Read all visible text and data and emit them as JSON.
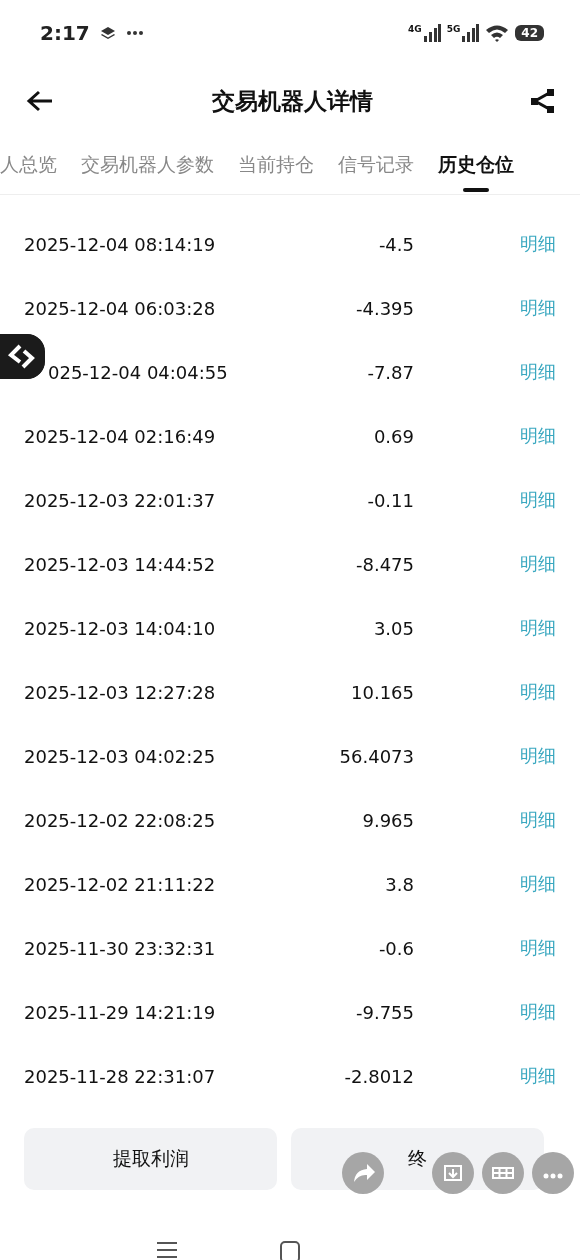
{
  "status_bar": {
    "time": "2:17",
    "network_1": "4G",
    "network_2": "5G",
    "battery": "42"
  },
  "header": {
    "title": "交易机器人详情"
  },
  "tabs": [
    {
      "label": "人总览",
      "selected": false
    },
    {
      "label": "交易机器人参数",
      "selected": false
    },
    {
      "label": "当前持仓",
      "selected": false
    },
    {
      "label": "信号记录",
      "selected": false
    },
    {
      "label": "历史仓位",
      "selected": true
    }
  ],
  "rows": [
    {
      "time": "2025-12-04 08:14:19",
      "value": "-4.5",
      "link": "明细"
    },
    {
      "time": "2025-12-04 06:03:28",
      "value": "-4.395",
      "link": "明细"
    },
    {
      "time": "025-12-04 04:04:55",
      "value": "-7.87",
      "link": "明细",
      "partial": true
    },
    {
      "time": "2025-12-04 02:16:49",
      "value": "0.69",
      "link": "明细"
    },
    {
      "time": "2025-12-03 22:01:37",
      "value": "-0.11",
      "link": "明细"
    },
    {
      "time": "2025-12-03 14:44:52",
      "value": "-8.475",
      "link": "明细"
    },
    {
      "time": "2025-12-03 14:04:10",
      "value": "3.05",
      "link": "明细"
    },
    {
      "time": "2025-12-03 12:27:28",
      "value": "10.165",
      "link": "明细"
    },
    {
      "time": "2025-12-03 04:02:25",
      "value": "56.4073",
      "link": "明细"
    },
    {
      "time": "2025-12-02 22:08:25",
      "value": "9.965",
      "link": "明细"
    },
    {
      "time": "2025-12-02 21:11:22",
      "value": "3.8",
      "link": "明细"
    },
    {
      "time": "2025-11-30 23:32:31",
      "value": "-0.6",
      "link": "明细"
    },
    {
      "time": "2025-11-29 14:21:19",
      "value": "-9.755",
      "link": "明细"
    },
    {
      "time": "2025-11-28 22:31:07",
      "value": "-2.8012",
      "link": "明细"
    }
  ],
  "buttons": [
    "提取利润",
    "终"
  ]
}
